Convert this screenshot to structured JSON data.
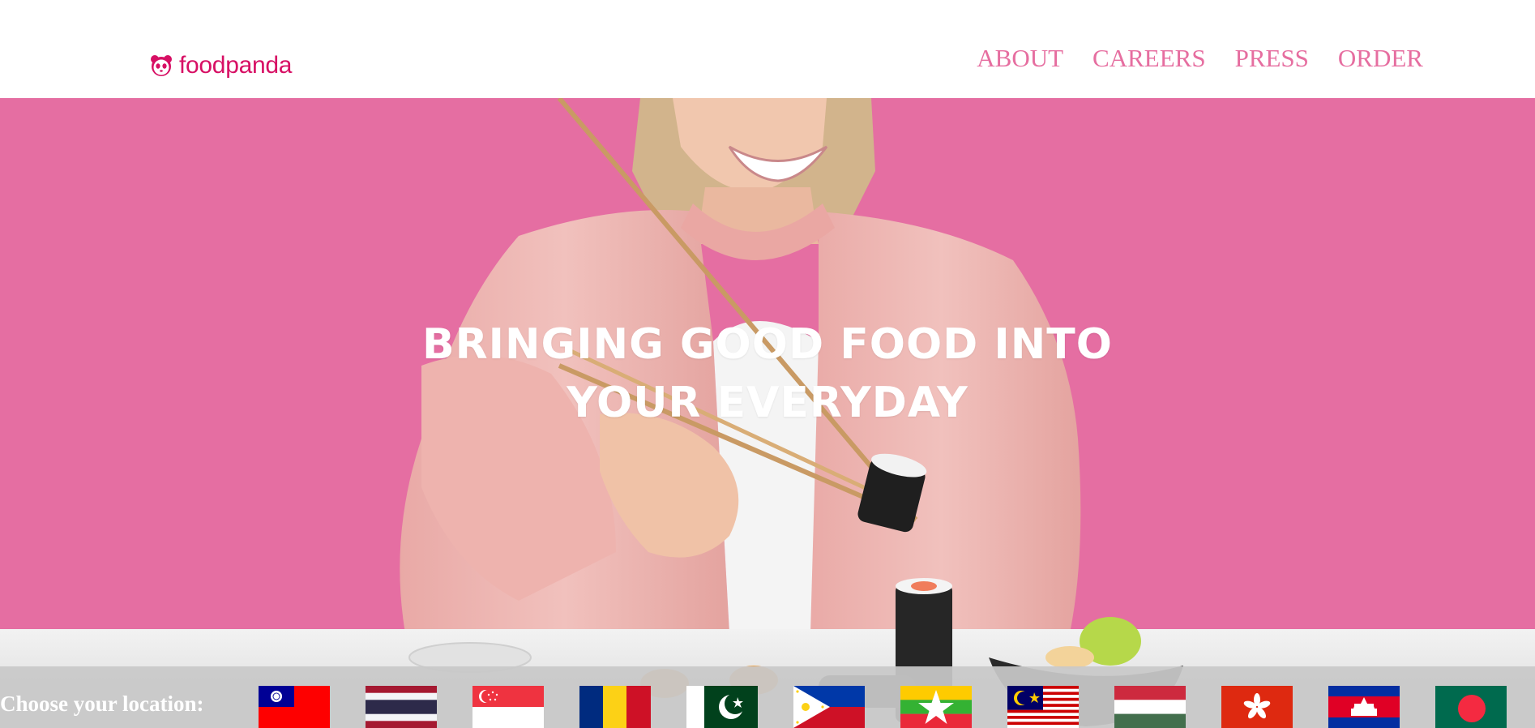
{
  "page": {
    "menu_glyph": "="
  },
  "brand": {
    "name": "foodpanda",
    "color": "#d70f64"
  },
  "nav": {
    "color": "#e66ea0",
    "items": [
      {
        "id": "about",
        "label": "ABOUT"
      },
      {
        "id": "careers",
        "label": "CAREERS"
      },
      {
        "id": "press",
        "label": "PRESS"
      },
      {
        "id": "order",
        "label": "ORDER"
      }
    ]
  },
  "hero": {
    "background": "#e56ea2",
    "headline_line1": "BRINGING GOOD FOOD INTO",
    "headline_line2": "YOUR EVERYDAY"
  },
  "locations": {
    "label": "Choose your location:",
    "flags": [
      {
        "icon": "flag-taiwan-icon"
      },
      {
        "icon": "flag-thailand-icon"
      },
      {
        "icon": "flag-singapore-icon"
      },
      {
        "icon": "flag-romania-icon"
      },
      {
        "icon": "flag-pakistan-icon"
      },
      {
        "icon": "flag-philippines-icon"
      },
      {
        "icon": "flag-myanmar-icon"
      },
      {
        "icon": "flag-malaysia-icon"
      },
      {
        "icon": "flag-hungary-icon"
      },
      {
        "icon": "flag-hong-kong-icon"
      },
      {
        "icon": "flag-cambodia-icon"
      },
      {
        "icon": "flag-bangladesh-icon"
      }
    ]
  }
}
